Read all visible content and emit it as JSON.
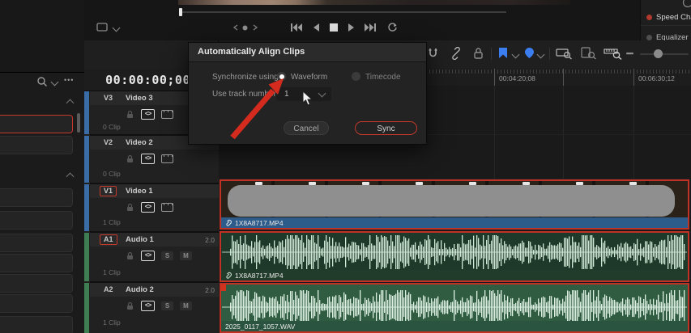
{
  "right_panel": {
    "items": [
      {
        "label": "Speed Cha",
        "dot_color": "#b03a2e"
      },
      {
        "label": "Equalizer",
        "dot_color": "#4f4f4f"
      }
    ]
  },
  "timecode": "00:00:00;00",
  "dialog": {
    "title": "Automatically Align Clips",
    "synchronize_label": "Synchronize using",
    "option_waveform": "Waveform",
    "option_timecode": "Timecode",
    "track_number_label": "Use track number",
    "track_number_value": "1",
    "cancel_label": "Cancel",
    "sync_label": "Sync"
  },
  "tracks": [
    {
      "badge": "V3",
      "name": "Video 3",
      "clip_count": "0 Clip"
    },
    {
      "badge": "V2",
      "name": "Video 2",
      "clip_count": "0 Clip"
    },
    {
      "badge": "V1",
      "name": "Video 1",
      "clip_count": "1 Clip"
    },
    {
      "badge": "A1",
      "name": "Audio 1",
      "channels": "2.0",
      "clip_count": "1 Clip"
    },
    {
      "badge": "A2",
      "name": "Audio 2",
      "channels": "2.0",
      "clip_count": "1 Clip"
    }
  ],
  "icons": {
    "more": "•••",
    "track_selector": "<>",
    "solo": "S",
    "mute": "M"
  },
  "ruler": {
    "labels": [
      {
        "text": "00:04:20;08"
      },
      {
        "text": "00:06:30;12"
      }
    ]
  },
  "clips": {
    "video1": {
      "name": "1X8A8717.MP4"
    },
    "audio1": {
      "name": "1X8A8717.MP4"
    },
    "audio2": {
      "name": "2025_0117_1057.WAV"
    }
  },
  "colors": {
    "selection_red": "#c23a2e",
    "arrow_red": "#d52b1e",
    "accent_blue": "#3b7ef0",
    "video_label_blue": "#2e5c8a",
    "audio_clip_green": "#1e3829",
    "audio_clip2_green": "#305c42"
  }
}
